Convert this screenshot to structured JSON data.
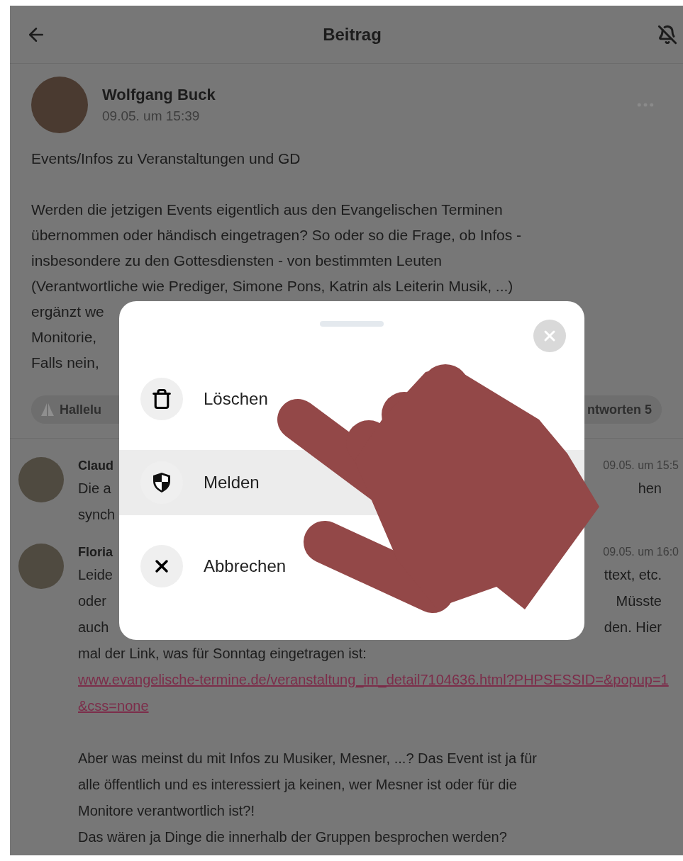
{
  "header": {
    "title": "Beitrag"
  },
  "post": {
    "author": "Wolfgang Buck",
    "time": "09.05. um 15:39",
    "title": "Events/Infos zu Veranstaltungen und GD",
    "lines": [
      {
        "left": "Werden die jetzigen Events eigentlich aus den Evangelischen Terminen"
      },
      {
        "left": "übernommen oder händisch eingetragen? So oder so die Frage, ob Infos -"
      },
      {
        "left": "insbesondere zu den Gottesdiensten - von bestimmten Leuten"
      },
      {
        "left": "(Verantwortliche wie Prediger, Simone Pons, Katrin als Leiterin Musik, ...)"
      },
      {
        "left": "ergänzt we"
      },
      {
        "left": "Monitorie,"
      },
      {
        "left": "Falls nein,"
      }
    ],
    "reaction": "Hallelu",
    "replies": "ntworten 5"
  },
  "comments": [
    {
      "author": "Claud",
      "time": "09.05. um 15:5",
      "lines": [
        {
          "left": "Die a",
          "right": "hen"
        },
        {
          "left": "synch"
        }
      ]
    },
    {
      "author": "Floria",
      "time": "09.05. um 16:0",
      "lines": [
        {
          "left": "Leide",
          "right": "ttext, etc."
        },
        {
          "left": "oder",
          "right": "Müsste"
        },
        {
          "left": "auch",
          "right": "den. Hier"
        }
      ],
      "link_text": "mal der Link, was für Sonntag eingetragen ist:",
      "link": "www.evangelische-termine.de/veranstaltung_im_detail7104636.html?PHPSESSID=&popup=1&css=none",
      "paragraph": [
        "Aber was meinst du mit Infos zu Musiker, Mesner, ...? Das Event ist ja für",
        "alle öffentlich und es interessiert ja keinen, wer Mesner ist oder für die",
        "Monitore verantwortlich ist?!",
        "Das wären ja Dinge die innerhalb der Gruppen besprochen werden?"
      ]
    }
  ],
  "sheet": {
    "options": [
      {
        "kind": "trash",
        "label": "Löschen",
        "highlighted": false
      },
      {
        "kind": "shield",
        "label": "Melden",
        "highlighted": true
      },
      {
        "kind": "close",
        "label": "Abbrechen",
        "highlighted": false
      }
    ]
  }
}
